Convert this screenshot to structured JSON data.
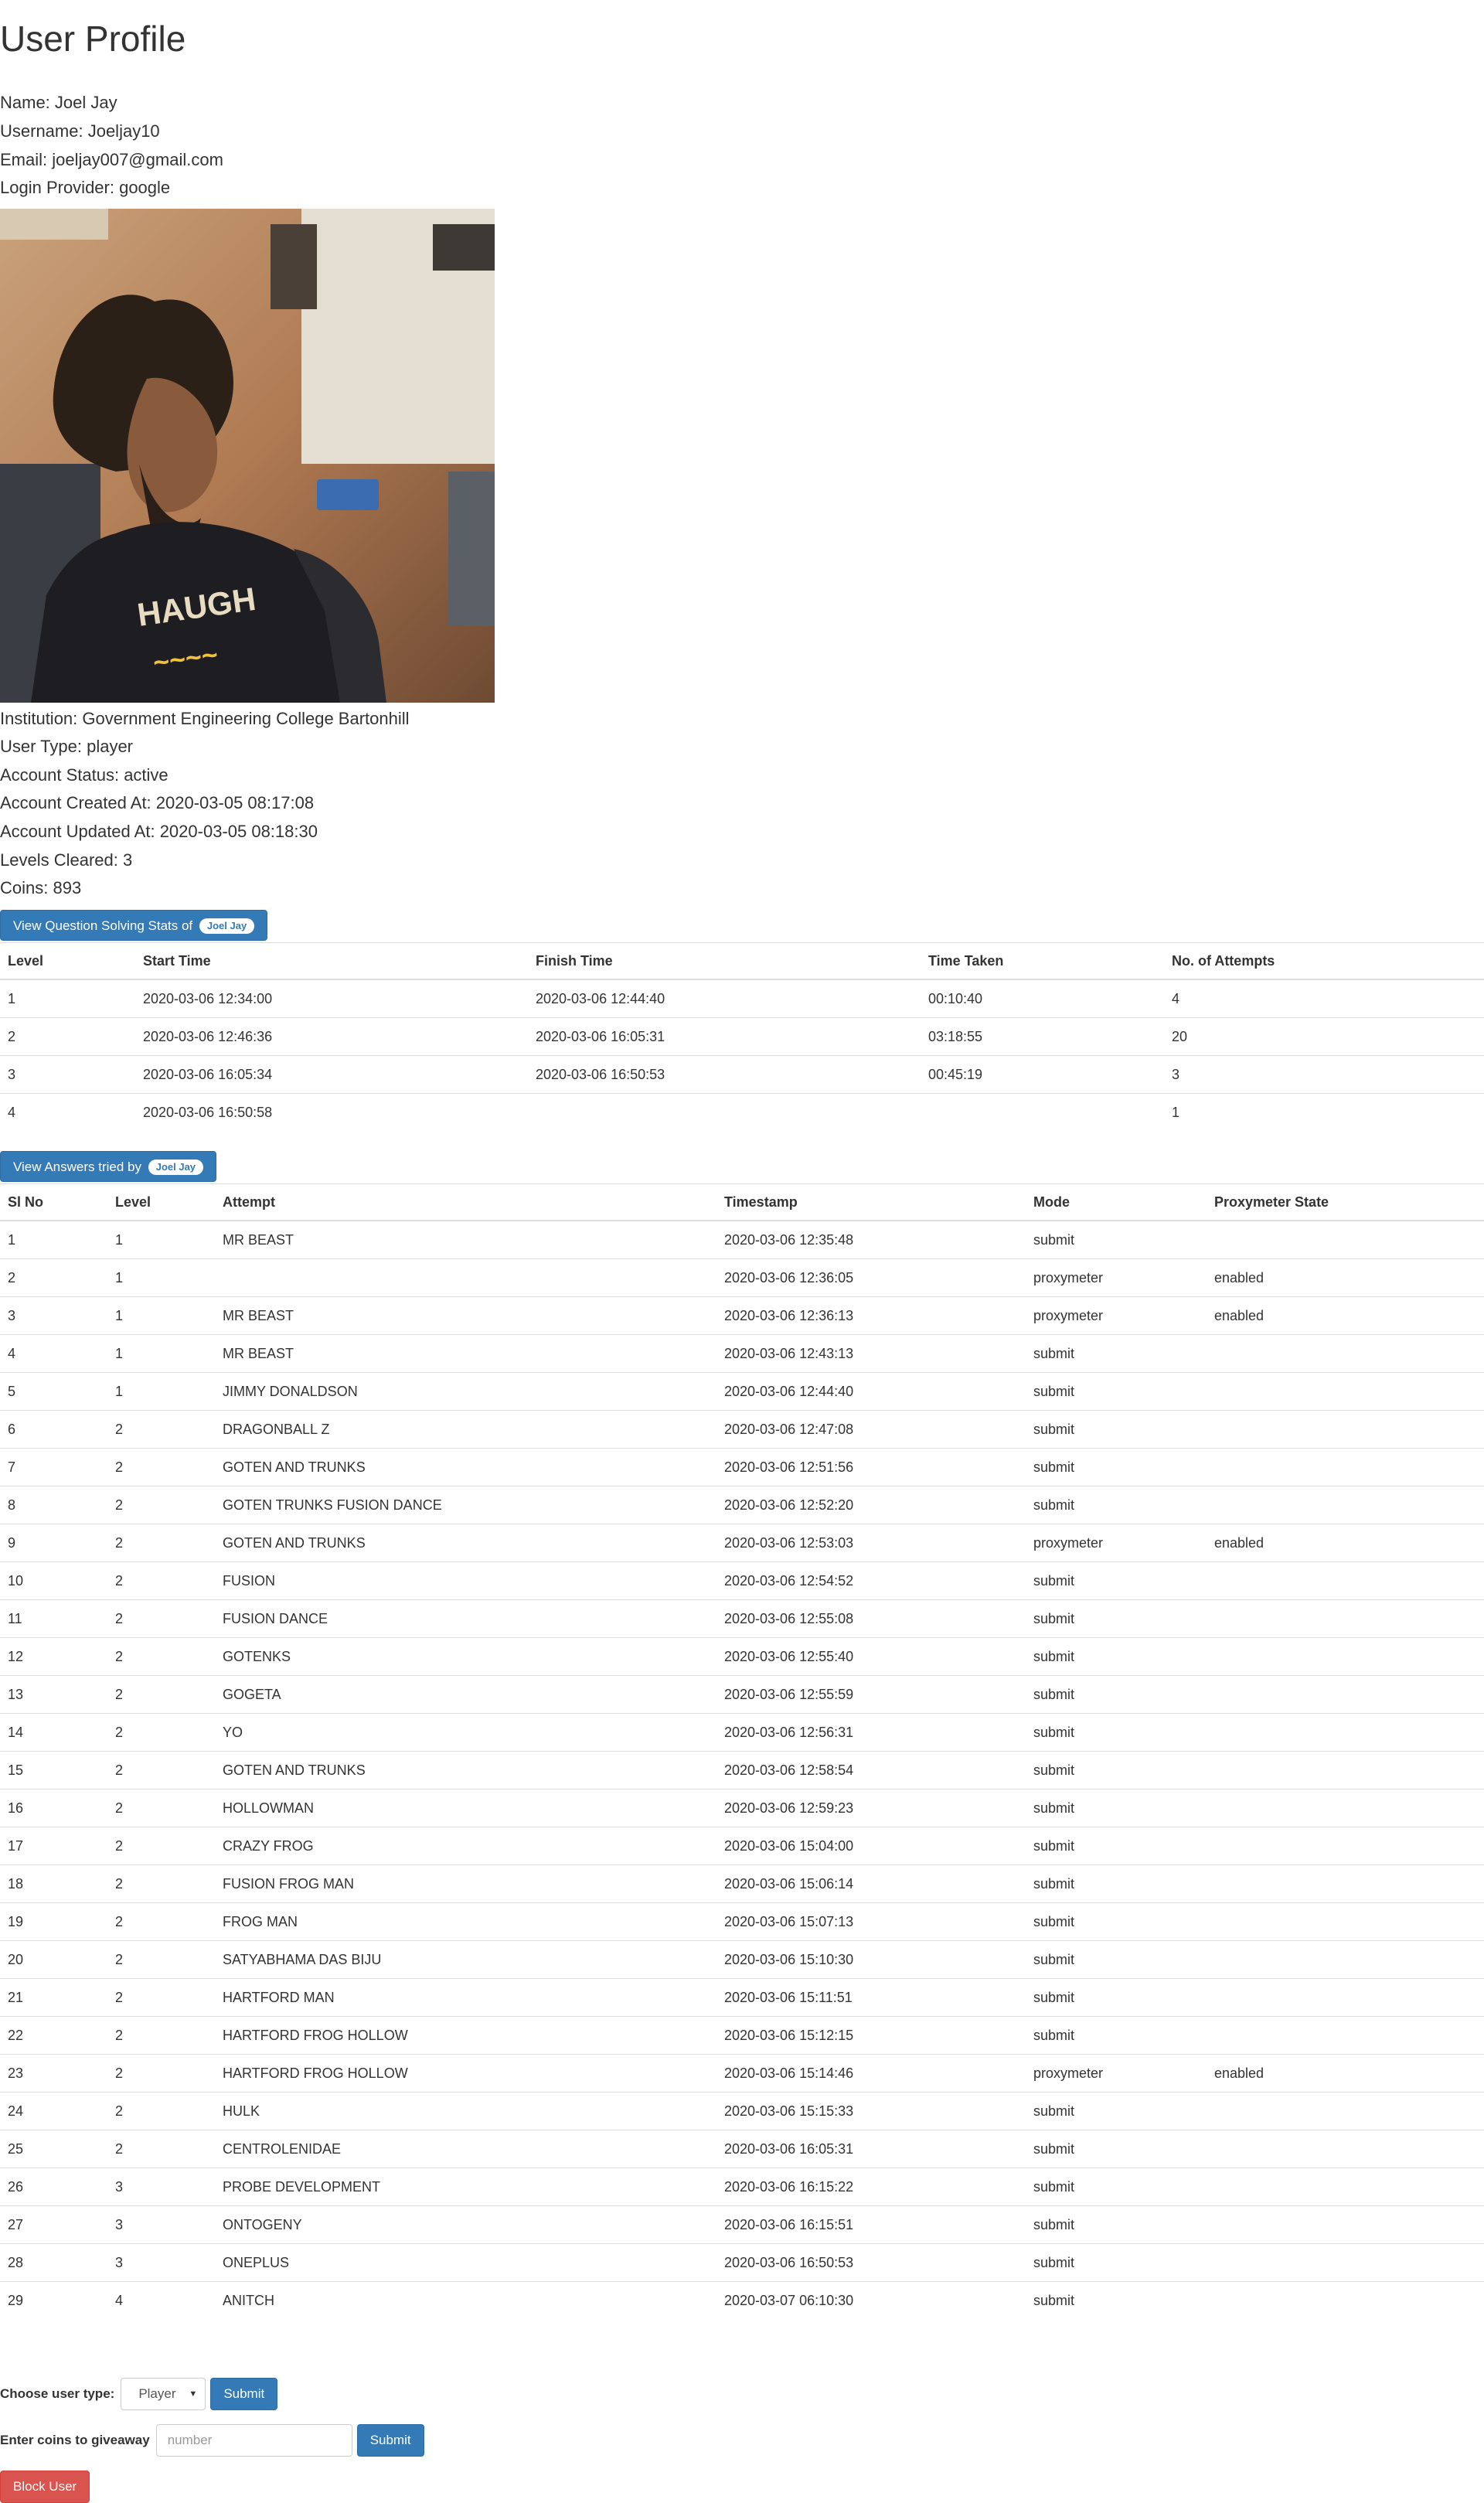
{
  "page_title": "User Profile",
  "profile": {
    "name": "Name: Joel Jay",
    "username": "Username: Joeljay10",
    "email": "Email: joeljay007@gmail.com",
    "login_provider": "Login Provider: google",
    "institution": "Institution: Government Engineering College Bartonhill",
    "user_type": "User Type: player",
    "account_status": "Account Status: active",
    "created_at": "Account Created At: 2020-03-05 08:17:08",
    "updated_at": "Account Updated At: 2020-03-05 08:18:30",
    "levels_cleared": "Levels Cleared: 3",
    "coins": "Coins: 893"
  },
  "stats_button": {
    "label": "View Question Solving Stats of",
    "badge": "Joel Jay"
  },
  "stats_table": {
    "headers": [
      "Level",
      "Start Time",
      "Finish Time",
      "Time Taken",
      "No. of Attempts"
    ],
    "rows": [
      [
        "1",
        "2020-03-06 12:34:00",
        "2020-03-06 12:44:40",
        "00:10:40",
        "4"
      ],
      [
        "2",
        "2020-03-06 12:46:36",
        "2020-03-06 16:05:31",
        "03:18:55",
        "20"
      ],
      [
        "3",
        "2020-03-06 16:05:34",
        "2020-03-06 16:50:53",
        "00:45:19",
        "3"
      ],
      [
        "4",
        "2020-03-06 16:50:58",
        "",
        "",
        "1"
      ]
    ]
  },
  "answers_button": {
    "label": "View Answers tried by",
    "badge": "Joel Jay"
  },
  "answers_table": {
    "headers": [
      "Sl No",
      "Level",
      "Attempt",
      "Timestamp",
      "Mode",
      "Proxymeter State"
    ],
    "rows": [
      [
        "1",
        "1",
        "MR BEAST",
        "2020-03-06 12:35:48",
        "submit",
        ""
      ],
      [
        "2",
        "1",
        "",
        "2020-03-06 12:36:05",
        "proxymeter",
        "enabled"
      ],
      [
        "3",
        "1",
        "MR BEAST",
        "2020-03-06 12:36:13",
        "proxymeter",
        "enabled"
      ],
      [
        "4",
        "1",
        "MR BEAST",
        "2020-03-06 12:43:13",
        "submit",
        ""
      ],
      [
        "5",
        "1",
        "JIMMY DONALDSON",
        "2020-03-06 12:44:40",
        "submit",
        ""
      ],
      [
        "6",
        "2",
        "DRAGONBALL Z",
        "2020-03-06 12:47:08",
        "submit",
        ""
      ],
      [
        "7",
        "2",
        "GOTEN AND TRUNKS",
        "2020-03-06 12:51:56",
        "submit",
        ""
      ],
      [
        "8",
        "2",
        "GOTEN TRUNKS FUSION DANCE",
        "2020-03-06 12:52:20",
        "submit",
        ""
      ],
      [
        "9",
        "2",
        "GOTEN AND TRUNKS",
        "2020-03-06 12:53:03",
        "proxymeter",
        "enabled"
      ],
      [
        "10",
        "2",
        "FUSION",
        "2020-03-06 12:54:52",
        "submit",
        ""
      ],
      [
        "11",
        "2",
        "FUSION DANCE",
        "2020-03-06 12:55:08",
        "submit",
        ""
      ],
      [
        "12",
        "2",
        "GOTENKS",
        "2020-03-06 12:55:40",
        "submit",
        ""
      ],
      [
        "13",
        "2",
        "GOGETA",
        "2020-03-06 12:55:59",
        "submit",
        ""
      ],
      [
        "14",
        "2",
        "YO",
        "2020-03-06 12:56:31",
        "submit",
        ""
      ],
      [
        "15",
        "2",
        "GOTEN AND TRUNKS",
        "2020-03-06 12:58:54",
        "submit",
        ""
      ],
      [
        "16",
        "2",
        "HOLLOWMAN",
        "2020-03-06 12:59:23",
        "submit",
        ""
      ],
      [
        "17",
        "2",
        "CRAZY FROG",
        "2020-03-06 15:04:00",
        "submit",
        ""
      ],
      [
        "18",
        "2",
        "FUSION FROG MAN",
        "2020-03-06 15:06:14",
        "submit",
        ""
      ],
      [
        "19",
        "2",
        "FROG MAN",
        "2020-03-06 15:07:13",
        "submit",
        ""
      ],
      [
        "20",
        "2",
        "SATYABHAMA DAS BIJU",
        "2020-03-06 15:10:30",
        "submit",
        ""
      ],
      [
        "21",
        "2",
        "HARTFORD MAN",
        "2020-03-06 15:11:51",
        "submit",
        ""
      ],
      [
        "22",
        "2",
        "HARTFORD FROG HOLLOW",
        "2020-03-06 15:12:15",
        "submit",
        ""
      ],
      [
        "23",
        "2",
        "HARTFORD FROG HOLLOW",
        "2020-03-06 15:14:46",
        "proxymeter",
        "enabled"
      ],
      [
        "24",
        "2",
        "HULK",
        "2020-03-06 15:15:33",
        "submit",
        ""
      ],
      [
        "25",
        "2",
        "CENTROLENIDAE",
        "2020-03-06 16:05:31",
        "submit",
        ""
      ],
      [
        "26",
        "3",
        "PROBE DEVELOPMENT",
        "2020-03-06 16:15:22",
        "submit",
        ""
      ],
      [
        "27",
        "3",
        "ONTOGENY",
        "2020-03-06 16:15:51",
        "submit",
        ""
      ],
      [
        "28",
        "3",
        "ONEPLUS",
        "2020-03-06 16:50:53",
        "submit",
        ""
      ],
      [
        "29",
        "4",
        "ANITCH",
        "2020-03-07 06:10:30",
        "submit",
        ""
      ]
    ]
  },
  "user_type_form": {
    "label": "Choose user type:",
    "selected": "Player",
    "submit": "Submit"
  },
  "coins_form": {
    "label": "Enter coins to giveaway",
    "placeholder": "number",
    "submit": "Submit"
  },
  "block_button": {
    "label": "Block User"
  },
  "colors": {
    "primary": "#337ab7",
    "danger": "#d9534f",
    "text": "#333333",
    "border": "#dddddd"
  }
}
